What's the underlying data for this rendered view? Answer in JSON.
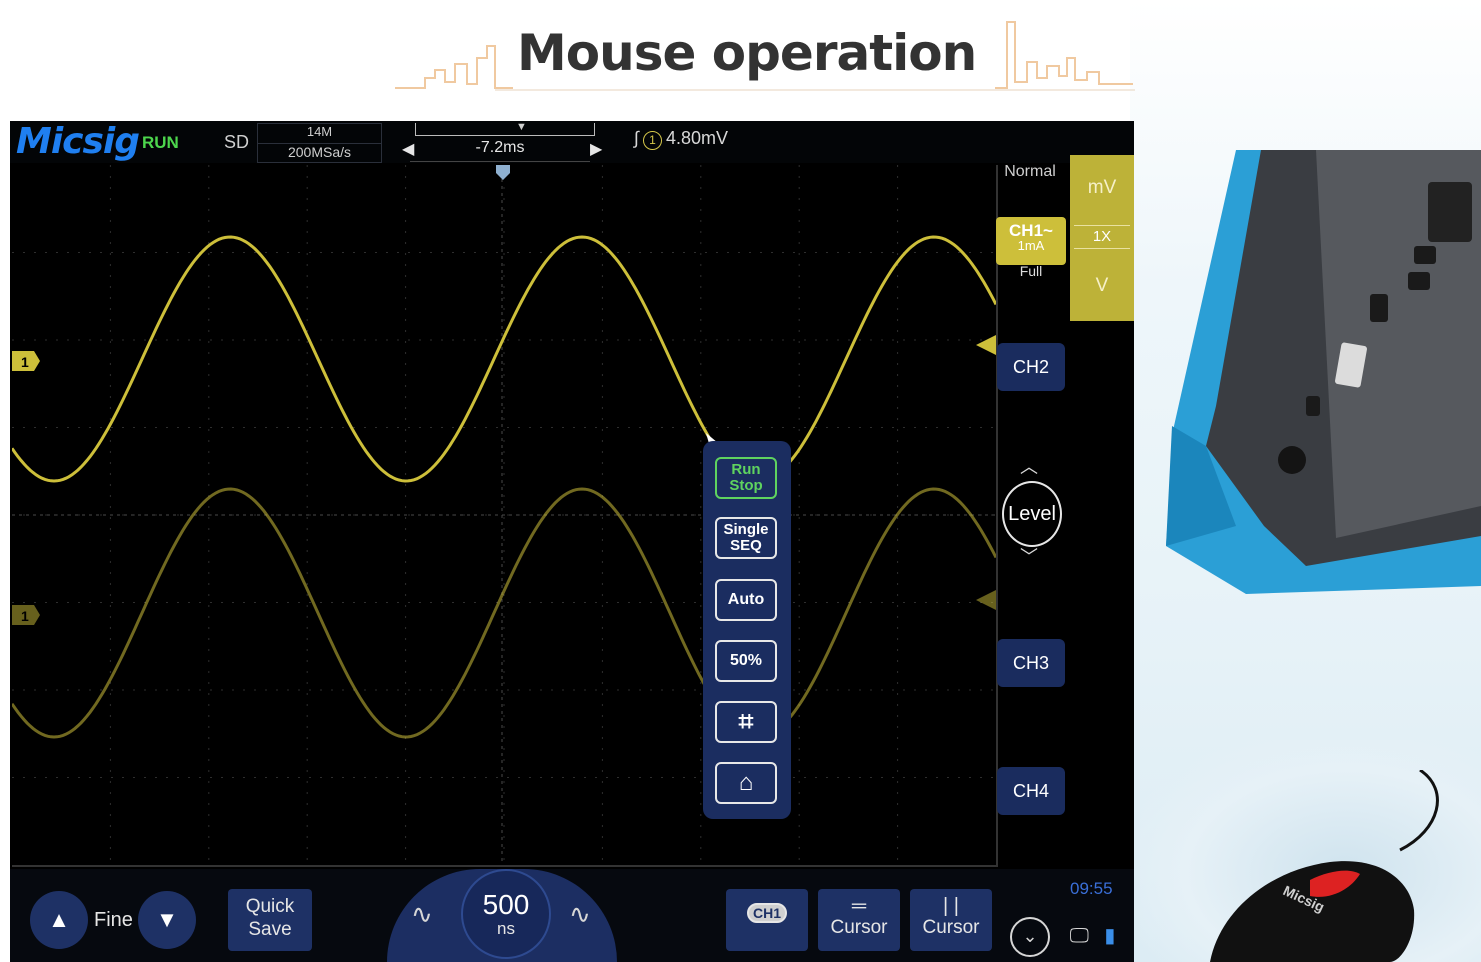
{
  "title": "Mouse operation",
  "scope": {
    "brand": "Micsig",
    "run_status": "RUN",
    "acq_res": "SD",
    "memory_depth": "14M",
    "sample_rate": "200MSa/s",
    "delay": "-7.2ms",
    "trigger_edge": "∫",
    "trigger_source": "1",
    "trigger_level": "4.80mV",
    "acq_mode": "Normal",
    "ch1": {
      "name": "CH1",
      "coupling": "~",
      "scale": "1mA",
      "bandwidth": "Full"
    },
    "scale_panel": {
      "unit_top": "mV",
      "probe": "1X",
      "unit_bottom": "V"
    },
    "channels": [
      "CH2",
      "CH3",
      "CH4"
    ],
    "level_label": "Level",
    "channel_marker": "1",
    "float_menu": {
      "run_stop": [
        "Run",
        "Stop"
      ],
      "single_seq": [
        "Single",
        "SEQ"
      ],
      "auto": "Auto",
      "fifty": "50%"
    },
    "bottom": {
      "fine_label": "Fine",
      "quick_save": [
        "Quick",
        "Save"
      ],
      "timebase_value": "500",
      "timebase_unit": "ns",
      "ch1_chip": "CH1",
      "cursor_h": "Cursor",
      "cursor_v": "Cursor",
      "clock": "09:55"
    },
    "colors": {
      "ch1": "#cdbf3a",
      "accent": "#1e3165",
      "run": "#4dd64d"
    }
  }
}
